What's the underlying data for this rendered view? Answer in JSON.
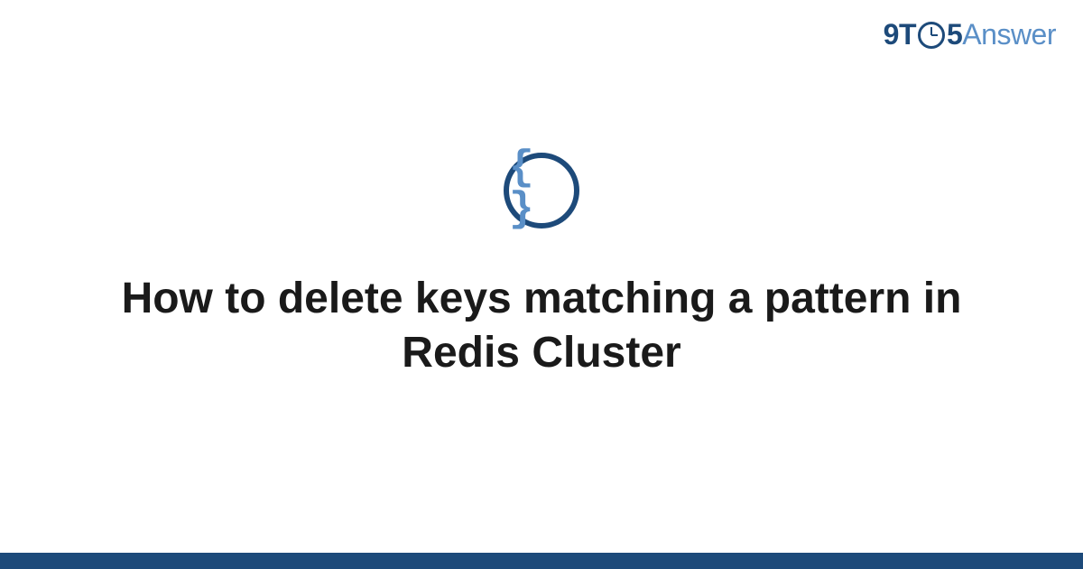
{
  "logo": {
    "part1": "9T",
    "part2": "5",
    "part3": "Answer"
  },
  "category_icon": {
    "name": "code-braces-icon",
    "symbol": "{ }"
  },
  "title": "How to delete keys matching a pattern in Redis Cluster",
  "colors": {
    "primary": "#1d4a7a",
    "accent": "#5a8fc7",
    "text": "#1a1a1a",
    "bg": "#ffffff"
  }
}
